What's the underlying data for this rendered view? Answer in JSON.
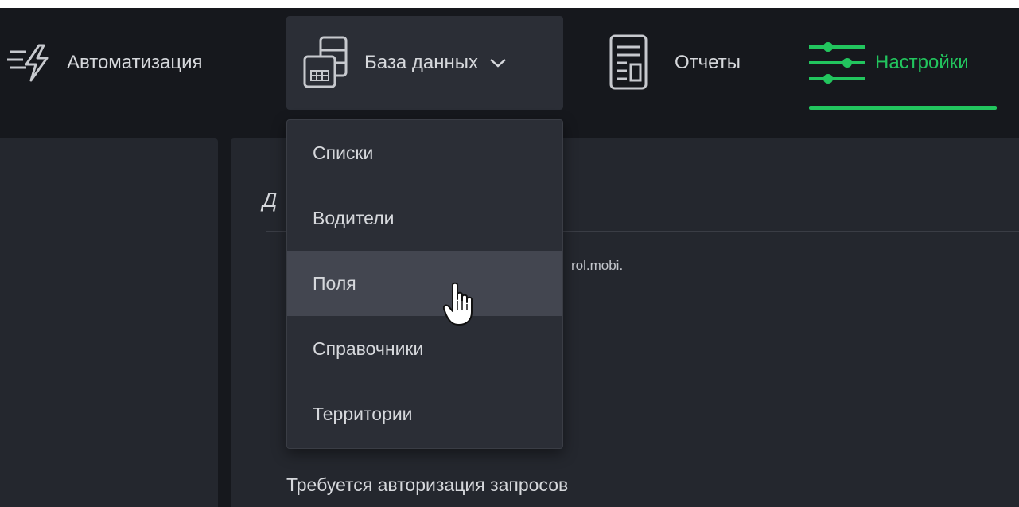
{
  "nav": {
    "automation": {
      "label": "Автоматизация",
      "icon": "lightning-icon"
    },
    "database": {
      "label": "База данных",
      "icon": "database-icon",
      "chevron": "chevron-down-icon"
    },
    "reports": {
      "label": "Отчеты",
      "icon": "report-icon"
    },
    "settings": {
      "label": "Настройки",
      "icon": "sliders-icon",
      "active": true,
      "accent_color": "#22c55e"
    }
  },
  "dropdown": {
    "items": [
      {
        "label": "Списки"
      },
      {
        "label": "Водители"
      },
      {
        "label": "Поля",
        "hovered": true
      },
      {
        "label": "Справочники"
      },
      {
        "label": "Территории"
      }
    ]
  },
  "content": {
    "heading_fragment": "Д",
    "text_fragment": "rol.mobi.",
    "auth_label": "Требуется авторизация запросов"
  },
  "colors": {
    "background": "#16181d",
    "panel": "#24272e",
    "dropdown": "#2b2e36",
    "hover": "#434650",
    "accent": "#22c55e",
    "text": "#d6d8dc"
  }
}
